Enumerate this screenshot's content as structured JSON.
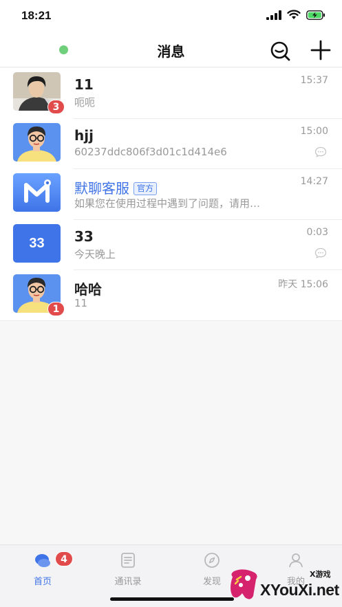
{
  "status_bar": {
    "time": "18:21"
  },
  "nav": {
    "title": "消息"
  },
  "conversations": [
    {
      "name": "11",
      "preview": "呃呃",
      "time": "15:37",
      "badge": "3"
    },
    {
      "name": "hjj",
      "preview": "60237ddc806f3d01c1d414e6",
      "time": "15:00"
    },
    {
      "name": "默聊客服",
      "tag": "官方",
      "preview": "如果您在使用过程中遇到了问题，请用…",
      "time": "14:27"
    },
    {
      "name": "33",
      "avatar_text": "33",
      "preview": "今天晚上",
      "time": "0:03"
    },
    {
      "name": "哈哈",
      "preview": "11",
      "time": "昨天 15:06",
      "badge": "1"
    }
  ],
  "tabs": [
    {
      "label": "首页",
      "badge": "4",
      "icon": "chat-bubbles-icon"
    },
    {
      "label": "通讯录",
      "icon": "contacts-icon"
    },
    {
      "label": "发现",
      "icon": "compass-icon"
    },
    {
      "label": "我的",
      "icon": "person-icon"
    }
  ],
  "watermark": {
    "brand": "XYouXi.net",
    "small": "X游戏"
  },
  "colors": {
    "accent": "#3f74e8",
    "badge": "#e24b4b",
    "online": "#6fcf7a"
  }
}
